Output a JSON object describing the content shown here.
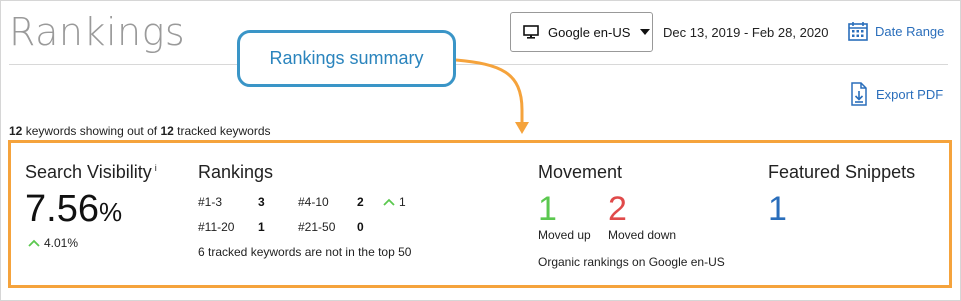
{
  "header": {
    "title": "Rankings",
    "engine_label": "Google en-US",
    "date_range": "Dec 13, 2019 - Feb 28, 2020",
    "date_range_button": "Date Range",
    "export_button": "Export PDF"
  },
  "callout": {
    "text": "Rankings summary"
  },
  "summary": {
    "keywords_shown": "12",
    "text_middle": "keywords showing out of",
    "keywords_tracked": "12",
    "text_end": "tracked keywords"
  },
  "search_visibility": {
    "title": "Search Visibility",
    "info": "i",
    "value": "7.56",
    "unit": "%",
    "change": "4.01%"
  },
  "rankings": {
    "title": "Rankings",
    "buckets": [
      {
        "label": "#1-3",
        "value": "3",
        "delta": ""
      },
      {
        "label": "#4-10",
        "value": "2",
        "delta": "1"
      },
      {
        "label": "#11-20",
        "value": "1",
        "delta": ""
      },
      {
        "label": "#21-50",
        "value": "0",
        "delta": ""
      }
    ],
    "note": "6 tracked keywords are not in the top 50"
  },
  "movement": {
    "title": "Movement",
    "up_value": "1",
    "up_label": "Moved up",
    "down_value": "2",
    "down_label": "Moved down",
    "note": "Organic rankings on Google en-US"
  },
  "featured_snippets": {
    "title": "Featured Snippets",
    "value": "1"
  },
  "colors": {
    "accent_blue": "#2a6ebb",
    "up_green": "#5bc84f",
    "down_red": "#e04a4a",
    "highlight_orange": "#f5a33c",
    "callout_blue": "#3a95c7"
  }
}
